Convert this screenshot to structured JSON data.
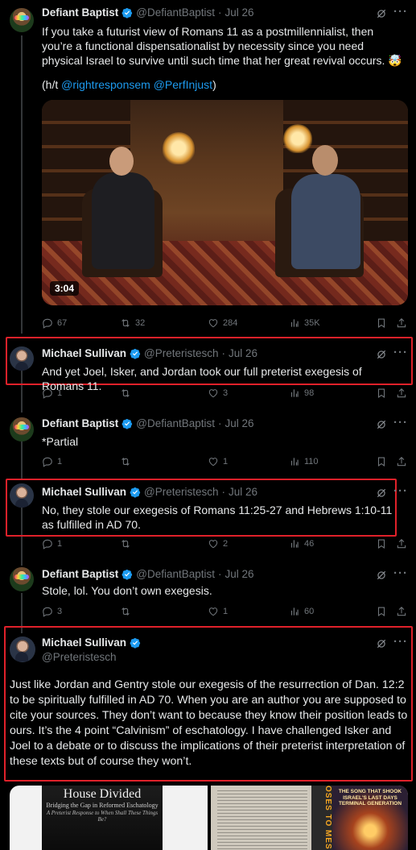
{
  "colors": {
    "background": "#000000",
    "text": "#e7e9ea",
    "muted": "#71767b",
    "link": "#1d9bf0",
    "verified": "#1d9bf0",
    "highlight_box": "#e0212a"
  },
  "tweets": [
    {
      "name": "Defiant Baptist",
      "handle": "@DefiantBaptist",
      "date": "Jul 26",
      "text": "If you take a futurist view of Romans 11 as a postmillennialist, then you’re a functional dispensationalist by necessity since you need physical Israel to survive until such time that her great revival occurs. 🤯",
      "hat_tip_prefix": "(h/t ",
      "mention_1": "@rightresponsem",
      "mention_2": "@PerfInjust",
      "hat_tip_suffix": ")",
      "video_duration": "3:04",
      "replies": "67",
      "reposts": "32",
      "likes": "284",
      "views": "35K"
    },
    {
      "name": "Michael Sullivan",
      "handle": "@Preteristesch",
      "date": "Jul 26",
      "text": "And yet Joel, Isker, and Jordan took our full preterist exegesis of Romans 11.",
      "replies": "1",
      "reposts": "",
      "likes": "3",
      "views": "98"
    },
    {
      "name": "Defiant Baptist",
      "handle": "@DefiantBaptist",
      "date": "Jul 26",
      "text": "*Partial",
      "replies": "1",
      "reposts": "",
      "likes": "1",
      "views": "110"
    },
    {
      "name": "Michael Sullivan",
      "handle": "@Preteristesch",
      "date": "Jul 26",
      "text": "No, they stole our exegesis of Romans 11:25-27 and Hebrews 1:10-11 as fulfilled in AD 70.",
      "replies": "1",
      "reposts": "",
      "likes": "2",
      "views": "46"
    },
    {
      "name": "Defiant Baptist",
      "handle": "@DefiantBaptist",
      "date": "Jul 26",
      "text": "Stole, lol. You don’t own exegesis.",
      "replies": "3",
      "reposts": "",
      "likes": "1",
      "views": "60"
    },
    {
      "name": "Michael Sullivan",
      "handle": "@Preteristesch",
      "text": "Just like Jordan and Gentry stole our exegesis of the resurrection of Dan. 12:2 to be spiritually fulfilled in AD 70.  When you are an author you are supposed to cite your sources.  They don’t want to because they know their position leads to ours.  It’s the 4 point “Calvinism” of eschatology.  I have challenged Isker and Joel to a debate or to discuss the implications of their preterist interpretation of these texts but of course they won’t."
    }
  ],
  "attachments": {
    "book_title": "House Divided",
    "book_subtitle": "Bridging the Gap in Reformed Eschatology",
    "book_subtitle_2": "A Preterist Response to When Shall These Things Be?",
    "vertical_title": "OSES TO MES",
    "poster_text": "THE SONG THAT SHOOK ISRAEL'S LAST DAYS TERMINAL GENERATION"
  }
}
